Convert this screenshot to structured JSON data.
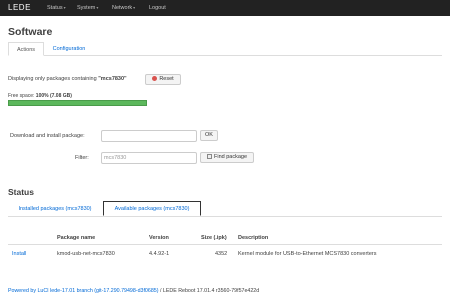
{
  "topbar": {
    "brand": "LEDE",
    "menu": [
      {
        "label": "Status"
      },
      {
        "label": "System"
      },
      {
        "label": "Network"
      },
      {
        "label": "Logout"
      }
    ]
  },
  "page": {
    "title": "Software"
  },
  "tabs": [
    {
      "label": "Actions",
      "active": true
    },
    {
      "label": "Configuration",
      "active": false
    }
  ],
  "filter_notice": {
    "prefix": "Displaying only packages containing ",
    "term": "\"mcs7830\"",
    "reset_label": "Reset"
  },
  "free_space": {
    "label": "Free space:",
    "value": "100% (7.08 GB)",
    "fraction": 1.0
  },
  "form": {
    "download_label": "Download and install package:",
    "download_value": "",
    "ok_label": "OK",
    "filter_label": "Filter:",
    "filter_value": "mcs7830",
    "find_label": "Find package"
  },
  "status": {
    "title": "Status",
    "tabs": [
      {
        "label": "Installed packages (mcs7830)",
        "active": false
      },
      {
        "label": "Available packages (mcs7830)",
        "active": true
      }
    ]
  },
  "table": {
    "headers": [
      "",
      "Package name",
      "Version",
      "Size (.ipk)",
      "Description"
    ],
    "rows": [
      {
        "action": "Install",
        "name": "kmod-usb-net-mcs7830",
        "version": "4.4.92-1",
        "size": "4352",
        "description": "Kernel module for USB-to-Ethernet MCS7830 converters"
      }
    ]
  },
  "footer": {
    "link_text": "Powered by LuCI lede-17.01 branch (git-17.290.79498-d3f0685)",
    "rest": " / LEDE Reboot 17.01.4 r3560-79f57e422d"
  },
  "colors": {
    "topbar_bg": "#222222",
    "link": "#0069d6",
    "progress": "#5cb85c",
    "reset_icon": "#d9534f"
  }
}
